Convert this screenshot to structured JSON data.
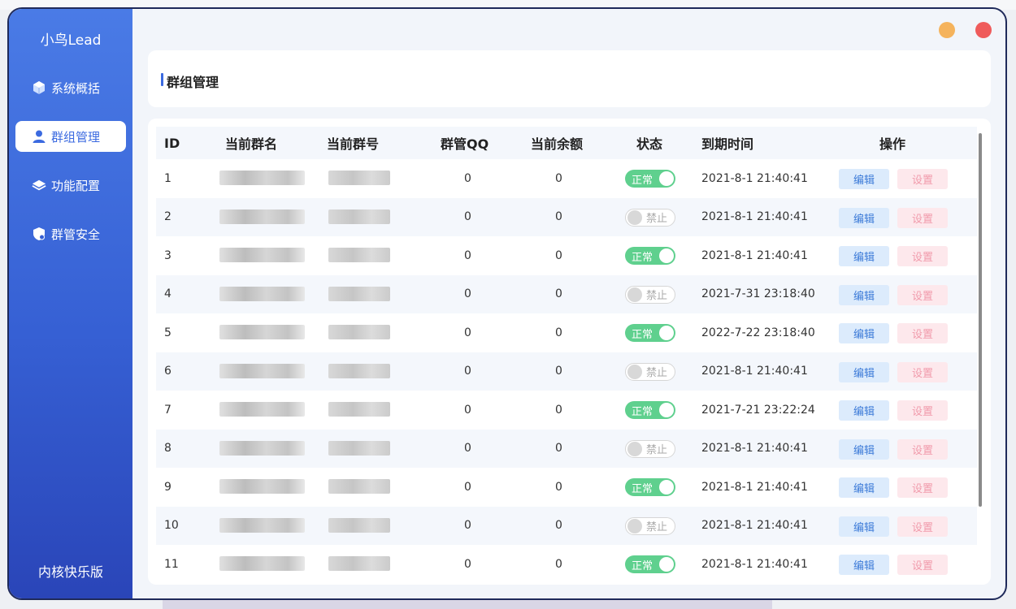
{
  "app": {
    "brand": "小鸟Lead",
    "version_label": "内核快乐版"
  },
  "sidebar": {
    "items": [
      {
        "label": "系统概括",
        "icon": "cube-icon",
        "active": false
      },
      {
        "label": "群组管理",
        "icon": "user-icon",
        "active": true
      },
      {
        "label": "功能配置",
        "icon": "layers-icon",
        "active": false
      },
      {
        "label": "群管安全",
        "icon": "shield-icon",
        "active": false
      }
    ]
  },
  "page": {
    "title": "群组管理"
  },
  "table": {
    "headers": {
      "id": "ID",
      "name": "当前群名",
      "number": "当前群号",
      "admin_qq": "群管QQ",
      "balance": "当前余额",
      "status": "状态",
      "expire": "到期时间",
      "actions": "操作"
    },
    "actions": {
      "edit": "编辑",
      "settings": "设置"
    },
    "status_labels": {
      "on": "正常",
      "off": "禁止"
    },
    "rows": [
      {
        "id": "1",
        "admin_qq": "0",
        "balance": "0",
        "enabled": true,
        "expire": "2021-8-1 21:40:41"
      },
      {
        "id": "2",
        "admin_qq": "0",
        "balance": "0",
        "enabled": false,
        "expire": "2021-8-1 21:40:41"
      },
      {
        "id": "3",
        "admin_qq": "0",
        "balance": "0",
        "enabled": true,
        "expire": "2021-8-1 21:40:41"
      },
      {
        "id": "4",
        "admin_qq": "0",
        "balance": "0",
        "enabled": false,
        "expire": "2021-7-31 23:18:40"
      },
      {
        "id": "5",
        "admin_qq": "0",
        "balance": "0",
        "enabled": true,
        "expire": "2022-7-22 23:18:40"
      },
      {
        "id": "6",
        "admin_qq": "0",
        "balance": "0",
        "enabled": false,
        "expire": "2021-8-1 21:40:41"
      },
      {
        "id": "7",
        "admin_qq": "0",
        "balance": "0",
        "enabled": true,
        "expire": "2021-7-21 23:22:24"
      },
      {
        "id": "8",
        "admin_qq": "0",
        "balance": "0",
        "enabled": false,
        "expire": "2021-8-1 21:40:41"
      },
      {
        "id": "9",
        "admin_qq": "0",
        "balance": "0",
        "enabled": true,
        "expire": "2021-8-1 21:40:41"
      },
      {
        "id": "10",
        "admin_qq": "0",
        "balance": "0",
        "enabled": false,
        "expire": "2021-8-1 21:40:41"
      },
      {
        "id": "11",
        "admin_qq": "0",
        "balance": "0",
        "enabled": true,
        "expire": "2021-8-1 21:40:41"
      }
    ]
  },
  "colors": {
    "sidebar_top": "#4a7be6",
    "sidebar_bottom": "#2a45b8",
    "accent": "#3b6ae0",
    "toggle_on": "#5fd08e",
    "minimize": "#f5b35c",
    "close": "#ef5b5b"
  }
}
